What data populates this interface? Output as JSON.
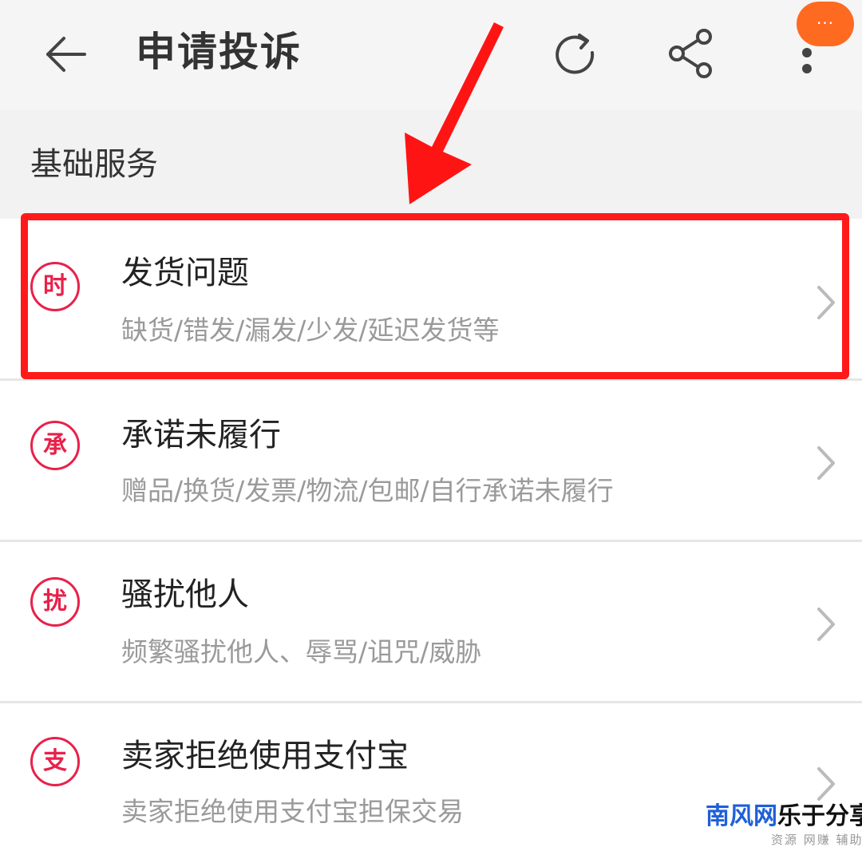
{
  "header": {
    "title": "申请投诉",
    "float_more_label": "···"
  },
  "section": {
    "title": "基础服务"
  },
  "items": [
    {
      "badge": "时",
      "title": "发货问题",
      "subtitle": "缺货/错发/漏发/少发/延迟发货等"
    },
    {
      "badge": "承",
      "title": "承诺未履行",
      "subtitle": "赠品/换货/发票/物流/包邮/自行承诺未履行"
    },
    {
      "badge": "扰",
      "title": "骚扰他人",
      "subtitle": "频繁骚扰他人、辱骂/诅咒/威胁"
    },
    {
      "badge": "支",
      "title": "卖家拒绝使用支付宝",
      "subtitle": "卖家拒绝使用支付宝担保交易"
    }
  ],
  "watermark": {
    "brand_blue": "南风网",
    "brand_dark": "乐于分享",
    "slogan": "资源 网赚 辅助"
  },
  "colors": {
    "accent_red": "#e8214a",
    "highlight_red": "#ff1a1a",
    "float_orange": "#ff6a21"
  },
  "icons": {
    "back": "arrow-left-icon",
    "refresh": "refresh-icon",
    "share": "share-icon",
    "more": "more-vertical-icon",
    "chevron": "chevron-right-icon"
  }
}
